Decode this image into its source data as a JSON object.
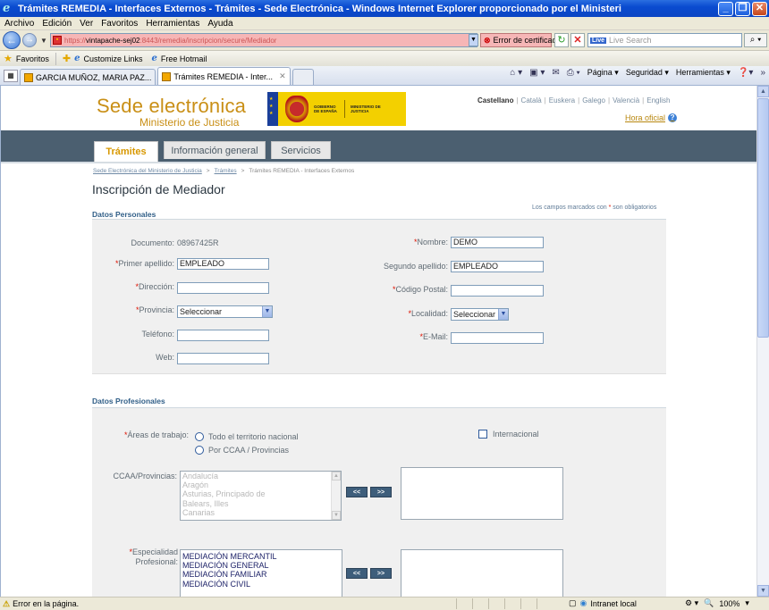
{
  "window": {
    "title": "Trámites REMEDIA - Interfaces Externos - Trámites - Sede Electrónica - Windows Internet Explorer proporcionado por el Ministeri"
  },
  "menu": [
    "Archivo",
    "Edición",
    "Ver",
    "Favoritos",
    "Herramientas",
    "Ayuda"
  ],
  "address": {
    "url_prefix": "https://",
    "url_host": "vintapache-sej02",
    "url_rest": ":8443/remedia/inscripcion/secure/Mediador",
    "cert_error": "Error de certificado",
    "search_placeholder": "Live Search",
    "search_brand": "Live"
  },
  "favorites": {
    "label": "Favoritos",
    "links": [
      "Customize Links",
      "Free Hotmail"
    ]
  },
  "browser_tabs": [
    {
      "label": "GARCIA MUÑOZ, MARIA PAZ..."
    },
    {
      "label": "Trámites REMEDIA - Inter..."
    }
  ],
  "command_bar": {
    "page": "Página",
    "security": "Seguridad",
    "tools": "Herramientas"
  },
  "site": {
    "brand_title": "Sede electrónica",
    "brand_sub": "Ministerio de Justicia",
    "gov_text": "GOBIERNO DE ESPAÑA",
    "ministry_text": "MINISTERIO DE JUSTICIA",
    "languages": [
      "Castellano",
      "Català",
      "Euskera",
      "Galego",
      "Valencià",
      "English"
    ],
    "hora_oficial": "Hora oficial",
    "help_glyph": "?",
    "tabs": [
      "Trámites",
      "Información general",
      "Servicios"
    ],
    "breadcrumb": {
      "link1": "Sede Electrónica del Ministerio de Justicia",
      "link2": "Trámites",
      "current": "Trámites REMEDIA - Interfaces Externos"
    },
    "page_title": "Inscripción de Mediador"
  },
  "personal": {
    "heading": "Datos Personales",
    "required_note_pre": "Los campos marcados con",
    "required_note_post": "son obligatorios",
    "asterisk": "*",
    "documento_label": "Documento:",
    "documento_value": "08967425R",
    "nombre_label": "Nombre:",
    "nombre_value": "DEMO",
    "primer_apellido_label": "Primer apellido:",
    "primer_apellido_value": "EMPLEADO",
    "segundo_apellido_label": "Segundo apellido:",
    "segundo_apellido_value": "EMPLEADO",
    "direccion_label": "Dirección:",
    "direccion_value": "",
    "codigo_postal_label": "Código Postal:",
    "codigo_postal_value": "",
    "provincia_label": "Provincia:",
    "provincia_value": "Seleccionar",
    "localidad_label": "Localidad:",
    "localidad_value": "Seleccionar",
    "telefono_label": "Teléfono:",
    "telefono_value": "",
    "email_label": "E-Mail:",
    "email_value": "",
    "web_label": "Web:",
    "web_value": ""
  },
  "professional": {
    "heading": "Datos Profesionales",
    "areas_label": "Áreas de trabajo:",
    "area_options": [
      "Todo el territorio nacional",
      "Por CCAA / Provincias"
    ],
    "internacional_label": "Internacional",
    "ccaa_label": "CCAA/Provincias:",
    "ccaa_options": [
      "Andalucía",
      "Aragón",
      "Asturias, Principado de",
      "Balears, Illes",
      "Canarias"
    ],
    "especialidad_label_1": "Especialidad",
    "especialidad_label_2": "Profesional:",
    "especialidad_options": [
      "MEDIACIÓN MERCANTIL",
      "MEDIACIÓN GENERAL",
      "MEDIACIÓN FAMILIAR",
      "MEDIACIÓN CIVIL"
    ],
    "btn_remove": "<<",
    "btn_add": ">>"
  },
  "status": {
    "message": "Error en la página.",
    "zone": "Intranet local",
    "zoom": "100%"
  }
}
